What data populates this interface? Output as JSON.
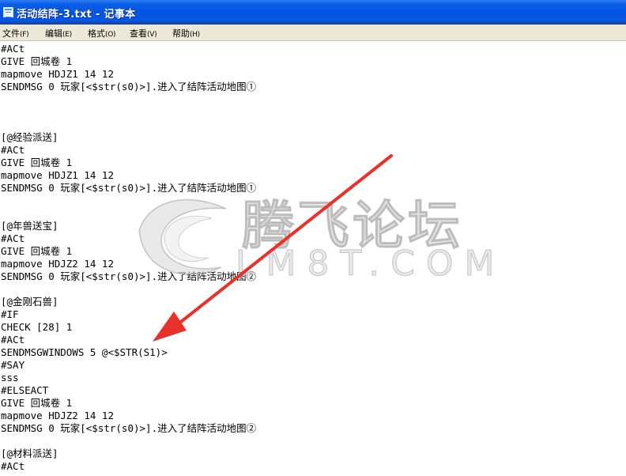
{
  "window": {
    "title": "活动结阵-3.txt - 记事本"
  },
  "menu": [
    {
      "label": "文件",
      "accel": "(F)"
    },
    {
      "label": "编辑",
      "accel": "(E)"
    },
    {
      "label": "格式",
      "accel": "(O)"
    },
    {
      "label": "查看",
      "accel": "(V)"
    },
    {
      "label": "帮助",
      "accel": "(H)"
    }
  ],
  "document": {
    "lines": [
      "#ACt",
      "GIVE 回城卷 1",
      "mapmove HDJZ1 14 12",
      "SENDMSG 0 玩家[<$str(s0)>].进入了结阵活动地图①",
      "",
      "",
      "",
      "[@经验派送]",
      "#ACt",
      "GIVE 回城卷 1",
      "mapmove HDJZ1 14 12",
      "SENDMSG 0 玩家[<$str(s0)>].进入了结阵活动地图①",
      "",
      "",
      "[@年兽送宝]",
      "#ACt",
      "GIVE 回城卷 1",
      "mapmove HDJZ2 14 12",
      "SENDMSG 0 玩家[<$str(s0)>].进入了结阵活动地图②",
      "",
      "[@金刚石兽]",
      "#IF",
      "CHECK [28] 1",
      "#ACt",
      "SENDMSGWINDOWS 5 @<$STR(S1)>",
      "#SAY",
      "sss",
      "#ELSEACT",
      "GIVE 回城卷 1",
      "mapmove HDJZ2 14 12",
      "SENDMSG 0 玩家[<$str(s0)>].进入了结阵活动地图②",
      "",
      "[@材料派送]",
      "#ACt"
    ]
  },
  "watermark": {
    "cn": "腾飞论坛",
    "en": "LM8T.COM"
  },
  "colors": {
    "arrow": "#e8312b",
    "titlebar": "#0054e3",
    "menubar": "#ece9d8"
  }
}
